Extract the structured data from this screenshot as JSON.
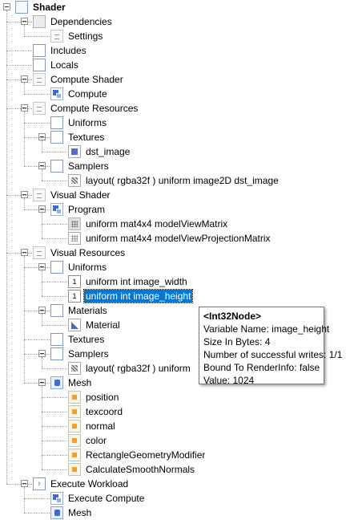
{
  "tree": {
    "rows": [
      {
        "name": "tree-node-shader",
        "depth": 0,
        "label": "Shader",
        "icon": "root",
        "icon_name": "shader-icon",
        "expanded": true,
        "bold": true
      },
      {
        "name": "tree-node-dependencies",
        "depth": 1,
        "label": "Dependencies",
        "icon": "gray",
        "icon_name": "dependencies-icon",
        "expanded": true
      },
      {
        "name": "tree-node-settings",
        "depth": 2,
        "label": "Settings",
        "icon": "doc",
        "icon_name": "settings-icon"
      },
      {
        "name": "tree-node-includes",
        "depth": 1,
        "label": "Includes",
        "icon": "blank",
        "icon_name": "folder-icon"
      },
      {
        "name": "tree-node-locals",
        "depth": 1,
        "label": "Locals",
        "icon": "blank",
        "icon_name": "folder-icon"
      },
      {
        "name": "tree-node-compute-shader",
        "depth": 1,
        "label": "Compute Shader",
        "icon": "doc",
        "icon_name": "shader-stage-icon",
        "expanded": true
      },
      {
        "name": "tree-node-compute",
        "depth": 2,
        "label": "Compute",
        "icon": "compute",
        "icon_name": "compute-icon"
      },
      {
        "name": "tree-node-compute-resources",
        "depth": 1,
        "label": "Compute Resources",
        "icon": "doc",
        "icon_name": "resources-icon",
        "expanded": true
      },
      {
        "name": "tree-node-uniforms",
        "depth": 2,
        "label": "Uniforms",
        "icon": "blank",
        "icon_name": "folder-icon"
      },
      {
        "name": "tree-node-textures",
        "depth": 2,
        "label": "Textures",
        "icon": "blank",
        "icon_name": "folder-icon",
        "expanded": true
      },
      {
        "name": "tree-node-dst-image",
        "depth": 3,
        "label": "dst_image",
        "icon": "tex",
        "icon_name": "texture-icon"
      },
      {
        "name": "tree-node-samplers",
        "depth": 2,
        "label": "Samplers",
        "icon": "blank",
        "icon_name": "folder-icon",
        "expanded": true
      },
      {
        "name": "tree-node-sampler-dst-image",
        "depth": 3,
        "label": "layout( rgba32f ) uniform image2D dst_image",
        "icon": "samp",
        "icon_name": "sampler-icon"
      },
      {
        "name": "tree-node-visual-shader",
        "depth": 1,
        "label": "Visual Shader",
        "icon": "doc",
        "icon_name": "shader-stage-icon",
        "expanded": true
      },
      {
        "name": "tree-node-program",
        "depth": 2,
        "label": "Program",
        "icon": "compute",
        "icon_name": "program-icon",
        "expanded": true
      },
      {
        "name": "tree-node-model-view-matrix",
        "depth": 3,
        "label": "uniform mat4x4 modelViewMatrix",
        "icon": "mat4x4",
        "icon_name": "matrix-icon"
      },
      {
        "name": "tree-node-model-view-projection-matrix",
        "depth": 3,
        "label": "uniform mat4x4 modelViewProjectionMatrix",
        "icon": "matrix",
        "icon_name": "matrix-icon"
      },
      {
        "name": "tree-node-visual-resources",
        "depth": 1,
        "label": "Visual Resources",
        "icon": "doc",
        "icon_name": "resources-icon",
        "expanded": true
      },
      {
        "name": "tree-node-uniforms",
        "depth": 2,
        "label": "Uniforms",
        "icon": "blank",
        "icon_name": "folder-icon",
        "expanded": true
      },
      {
        "name": "tree-node-image-width",
        "depth": 3,
        "label": "uniform int image_width",
        "icon": "num",
        "icon_name": "int-icon",
        "glyph": "1"
      },
      {
        "name": "tree-node-image-height",
        "depth": 3,
        "label": "uniform int image_height",
        "icon": "num",
        "icon_name": "int-icon",
        "glyph": "1",
        "selected": true
      },
      {
        "name": "tree-node-materials",
        "depth": 2,
        "label": "Materials",
        "icon": "blank",
        "icon_name": "folder-icon",
        "expanded": true
      },
      {
        "name": "tree-node-material",
        "depth": 3,
        "label": "Material",
        "icon": "mat",
        "icon_name": "material-icon"
      },
      {
        "name": "tree-node-textures",
        "depth": 2,
        "label": "Textures",
        "icon": "blank",
        "icon_name": "folder-icon"
      },
      {
        "name": "tree-node-samplers",
        "depth": 2,
        "label": "Samplers",
        "icon": "blank",
        "icon_name": "folder-icon",
        "expanded": true
      },
      {
        "name": "tree-node-sampler-uniform",
        "depth": 3,
        "label": "layout( rgba32f ) uniform",
        "icon": "samp",
        "icon_name": "sampler-icon"
      },
      {
        "name": "tree-node-mesh",
        "depth": 2,
        "label": "Mesh",
        "icon": "mesh",
        "icon_name": "mesh-icon",
        "expanded": true
      },
      {
        "name": "tree-node-position",
        "depth": 3,
        "label": "position",
        "icon": "attr",
        "icon_name": "attribute-icon"
      },
      {
        "name": "tree-node-texcoord",
        "depth": 3,
        "label": "texcoord",
        "icon": "attr",
        "icon_name": "attribute-icon"
      },
      {
        "name": "tree-node-normal",
        "depth": 3,
        "label": "normal",
        "icon": "attr",
        "icon_name": "attribute-icon"
      },
      {
        "name": "tree-node-color",
        "depth": 3,
        "label": "color",
        "icon": "attr",
        "icon_name": "attribute-icon"
      },
      {
        "name": "tree-node-rectangle-geometry-modifier",
        "depth": 3,
        "label": "RectangleGeometryModifier",
        "icon": "attr",
        "icon_name": "modifier-icon"
      },
      {
        "name": "tree-node-calculate-smooth-normals",
        "depth": 3,
        "label": "CalculateSmoothNormals",
        "icon": "attr",
        "icon_name": "modifier-icon"
      },
      {
        "name": "tree-node-execute-workload",
        "depth": 1,
        "label": "Execute Workload",
        "icon": "exec",
        "icon_name": "execute-icon",
        "expanded": true,
        "glyph": "›"
      },
      {
        "name": "tree-node-execute-compute",
        "depth": 2,
        "label": "Execute Compute",
        "icon": "compute",
        "icon_name": "compute-icon"
      },
      {
        "name": "tree-node-execute-mesh",
        "depth": 2,
        "label": "Mesh",
        "icon": "mesh",
        "icon_name": "mesh-icon"
      }
    ]
  },
  "tooltip": {
    "title": "<Int32Node>",
    "variable_name": "Variable Name: image_height",
    "size_in_bytes": "Size In Bytes: 4",
    "successful_writes": "Number of successful writes: 1/1",
    "bound_to_renderinfo": "Bound To RenderInfo: false",
    "value": "Value: 1024"
  }
}
